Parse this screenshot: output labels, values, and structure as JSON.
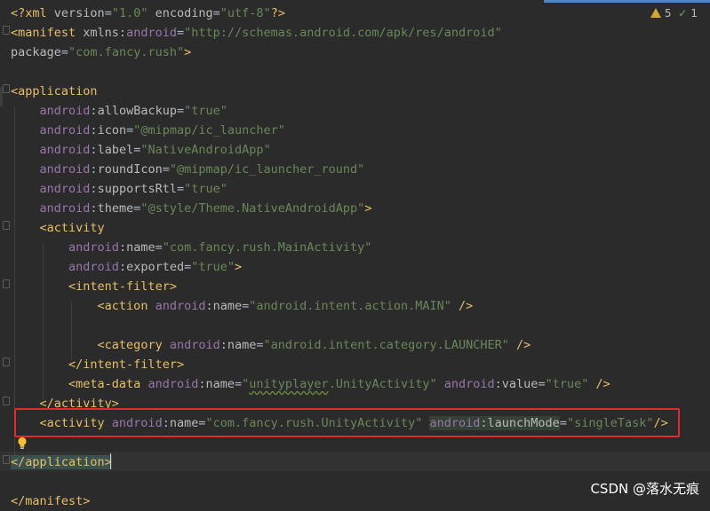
{
  "editor": {
    "lines": [
      {
        "segments": [
          {
            "t": "<?",
            "c": "tag"
          },
          {
            "t": "xml ",
            "c": "tag"
          },
          {
            "t": "version",
            "c": "attr"
          },
          {
            "t": "=",
            "c": "plain"
          },
          {
            "t": "\"1.0\"",
            "c": "val"
          },
          {
            "t": " ",
            "c": "plain"
          },
          {
            "t": "encoding",
            "c": "attr"
          },
          {
            "t": "=",
            "c": "plain"
          },
          {
            "t": "\"utf-8\"",
            "c": "val"
          },
          {
            "t": "?>",
            "c": "tag"
          }
        ]
      },
      {
        "segments": [
          {
            "t": "<manifest ",
            "c": "tag"
          },
          {
            "t": "xmlns",
            "c": "attr"
          },
          {
            "t": ":",
            "c": "plain"
          },
          {
            "t": "android",
            "c": "ns"
          },
          {
            "t": "=",
            "c": "plain"
          },
          {
            "t": "\"http://schemas.android.com/apk/res/android\"",
            "c": "val"
          }
        ]
      },
      {
        "segments": [
          {
            "t": "package",
            "c": "attr"
          },
          {
            "t": "=",
            "c": "plain"
          },
          {
            "t": "\"com.fancy.rush\"",
            "c": "val"
          },
          {
            "t": ">",
            "c": "tag"
          }
        ]
      },
      {
        "segments": []
      },
      {
        "segments": [
          {
            "t": "<application",
            "c": "tag"
          }
        ]
      },
      {
        "segments": [
          {
            "t": "    ",
            "c": "plain"
          },
          {
            "t": "android",
            "c": "ns"
          },
          {
            "t": ":",
            "c": "plain"
          },
          {
            "t": "allowBackup",
            "c": "attr"
          },
          {
            "t": "=",
            "c": "plain"
          },
          {
            "t": "\"true\"",
            "c": "val"
          }
        ]
      },
      {
        "segments": [
          {
            "t": "    ",
            "c": "plain"
          },
          {
            "t": "android",
            "c": "ns"
          },
          {
            "t": ":",
            "c": "plain"
          },
          {
            "t": "icon",
            "c": "attr"
          },
          {
            "t": "=",
            "c": "plain"
          },
          {
            "t": "\"@mipmap/ic_launcher\"",
            "c": "val"
          }
        ]
      },
      {
        "segments": [
          {
            "t": "    ",
            "c": "plain"
          },
          {
            "t": "android",
            "c": "ns"
          },
          {
            "t": ":",
            "c": "plain"
          },
          {
            "t": "label",
            "c": "attr"
          },
          {
            "t": "=",
            "c": "plain"
          },
          {
            "t": "\"NativeAndroidApp\"",
            "c": "val"
          }
        ]
      },
      {
        "segments": [
          {
            "t": "    ",
            "c": "plain"
          },
          {
            "t": "android",
            "c": "ns"
          },
          {
            "t": ":",
            "c": "plain"
          },
          {
            "t": "roundIcon",
            "c": "attr"
          },
          {
            "t": "=",
            "c": "plain"
          },
          {
            "t": "\"@mipmap/ic_launcher_round\"",
            "c": "val"
          }
        ]
      },
      {
        "segments": [
          {
            "t": "    ",
            "c": "plain"
          },
          {
            "t": "android",
            "c": "ns"
          },
          {
            "t": ":",
            "c": "plain"
          },
          {
            "t": "supportsRtl",
            "c": "attr"
          },
          {
            "t": "=",
            "c": "plain"
          },
          {
            "t": "\"true\"",
            "c": "val"
          }
        ]
      },
      {
        "segments": [
          {
            "t": "    ",
            "c": "plain"
          },
          {
            "t": "android",
            "c": "ns"
          },
          {
            "t": ":",
            "c": "plain"
          },
          {
            "t": "theme",
            "c": "attr"
          },
          {
            "t": "=",
            "c": "plain"
          },
          {
            "t": "\"@style/Theme.NativeAndroidApp\"",
            "c": "val"
          },
          {
            "t": ">",
            "c": "tag"
          }
        ]
      },
      {
        "segments": [
          {
            "t": "    ",
            "c": "plain"
          },
          {
            "t": "<activity",
            "c": "tag"
          }
        ]
      },
      {
        "segments": [
          {
            "t": "        ",
            "c": "plain"
          },
          {
            "t": "android",
            "c": "ns"
          },
          {
            "t": ":",
            "c": "plain"
          },
          {
            "t": "name",
            "c": "attr"
          },
          {
            "t": "=",
            "c": "plain"
          },
          {
            "t": "\"com.fancy.rush.MainActivity\"",
            "c": "val"
          }
        ]
      },
      {
        "segments": [
          {
            "t": "        ",
            "c": "plain"
          },
          {
            "t": "android",
            "c": "ns"
          },
          {
            "t": ":",
            "c": "plain"
          },
          {
            "t": "exported",
            "c": "attr"
          },
          {
            "t": "=",
            "c": "plain"
          },
          {
            "t": "\"true\"",
            "c": "val"
          },
          {
            "t": ">",
            "c": "tag"
          }
        ]
      },
      {
        "segments": [
          {
            "t": "        ",
            "c": "plain"
          },
          {
            "t": "<intent-filter>",
            "c": "tag"
          }
        ]
      },
      {
        "segments": [
          {
            "t": "            ",
            "c": "plain"
          },
          {
            "t": "<action ",
            "c": "tag"
          },
          {
            "t": "android",
            "c": "ns"
          },
          {
            "t": ":",
            "c": "plain"
          },
          {
            "t": "name",
            "c": "attr"
          },
          {
            "t": "=",
            "c": "plain"
          },
          {
            "t": "\"android.intent.action.MAIN\"",
            "c": "val"
          },
          {
            "t": " />",
            "c": "tag"
          }
        ]
      },
      {
        "segments": []
      },
      {
        "segments": [
          {
            "t": "            ",
            "c": "plain"
          },
          {
            "t": "<category ",
            "c": "tag"
          },
          {
            "t": "android",
            "c": "ns"
          },
          {
            "t": ":",
            "c": "plain"
          },
          {
            "t": "name",
            "c": "attr"
          },
          {
            "t": "=",
            "c": "plain"
          },
          {
            "t": "\"android.intent.category.LAUNCHER\"",
            "c": "val"
          },
          {
            "t": " />",
            "c": "tag"
          }
        ]
      },
      {
        "segments": [
          {
            "t": "        ",
            "c": "plain"
          },
          {
            "t": "</intent-filter>",
            "c": "tag"
          }
        ]
      },
      {
        "segments": [
          {
            "t": "        ",
            "c": "plain"
          },
          {
            "t": "<meta-data ",
            "c": "tag"
          },
          {
            "t": "android",
            "c": "ns"
          },
          {
            "t": ":",
            "c": "plain"
          },
          {
            "t": "name",
            "c": "attr"
          },
          {
            "t": "=",
            "c": "plain"
          },
          {
            "t": "\"",
            "c": "val"
          },
          {
            "t": "unityplayer",
            "c": "val squiggle"
          },
          {
            "t": ".UnityActivity\"",
            "c": "val"
          },
          {
            "t": " ",
            "c": "plain"
          },
          {
            "t": "android",
            "c": "ns"
          },
          {
            "t": ":",
            "c": "plain"
          },
          {
            "t": "value",
            "c": "attr"
          },
          {
            "t": "=",
            "c": "plain"
          },
          {
            "t": "\"true\"",
            "c": "val"
          },
          {
            "t": " />",
            "c": "tag"
          }
        ]
      },
      {
        "segments": [
          {
            "t": "    ",
            "c": "plain"
          },
          {
            "t": "</activity>",
            "c": "tag"
          }
        ]
      },
      {
        "segments": [
          {
            "t": "    ",
            "c": "plain"
          },
          {
            "t": "<activity ",
            "c": "tag"
          },
          {
            "t": "android",
            "c": "ns"
          },
          {
            "t": ":",
            "c": "plain"
          },
          {
            "t": "name",
            "c": "attr"
          },
          {
            "t": "=",
            "c": "plain"
          },
          {
            "t": "\"com.fancy.rush.UnityActivity\"",
            "c": "val"
          },
          {
            "t": " ",
            "c": "plain"
          },
          {
            "t": "android",
            "c": "ns param-bg"
          },
          {
            "t": ":",
            "c": "plain param-bg"
          },
          {
            "t": "launchMode",
            "c": "attr param-bg"
          },
          {
            "t": "=",
            "c": "plain"
          },
          {
            "t": "\"singleTask\"",
            "c": "val"
          },
          {
            "t": "/>",
            "c": "tag"
          }
        ]
      },
      {
        "segments": []
      },
      {
        "segments": [
          {
            "t": "</application>",
            "c": "tag bracket-bg"
          }
        ]
      },
      {
        "segments": []
      },
      {
        "segments": [
          {
            "t": "</manifest>",
            "c": "tag"
          }
        ]
      }
    ]
  },
  "status": {
    "warnings": "5",
    "weak_warnings": "1"
  },
  "watermark": "CSDN @落水无痕",
  "colors": {
    "background": "#2b2b2b",
    "tag": "#e8bf6a",
    "namespace": "#9876aa",
    "attribute": "#bababa",
    "string": "#6a8759",
    "annotation_box": "#e32a2a"
  }
}
